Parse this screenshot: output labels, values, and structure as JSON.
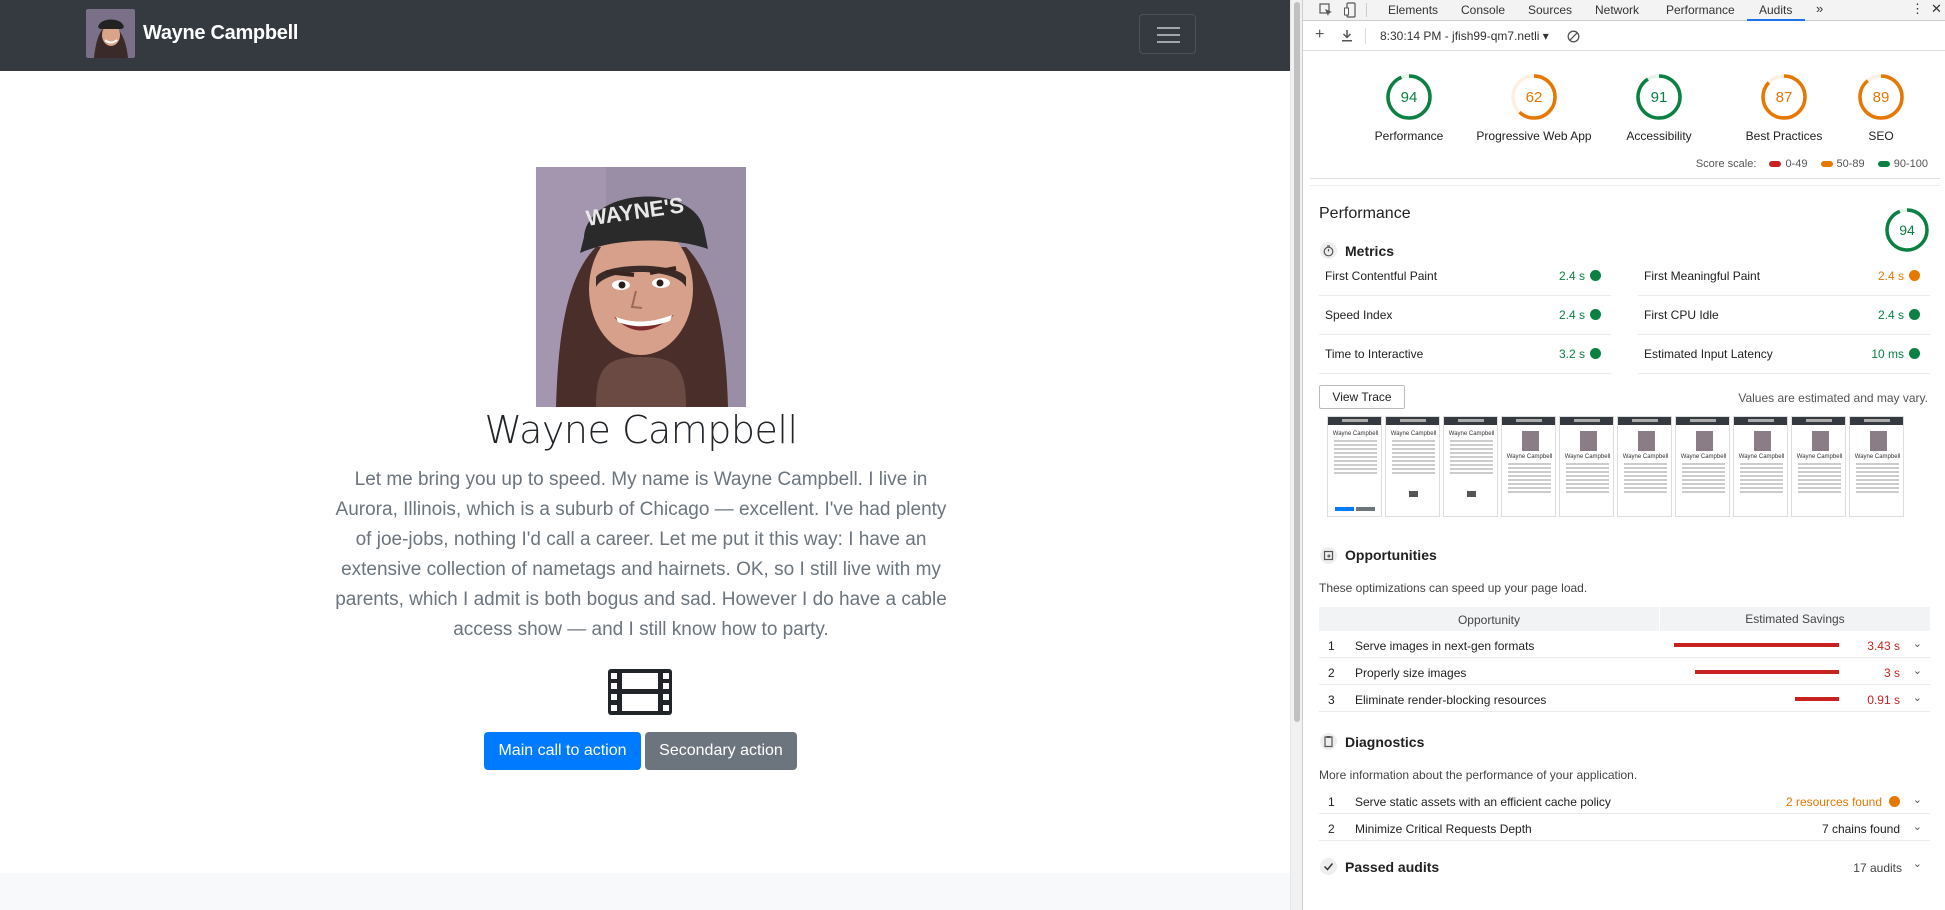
{
  "site": {
    "brand": "Wayne Campbell",
    "hero_title": "Wayne Campbell",
    "hero_text": "Let me bring you up to speed. My name is Wayne Campbell. I live in Aurora, Illinois, which is a suburb of Chicago — excellent. I've had plenty of joe-jobs, nothing I'd call a career. Let me put it this way: I have an extensive collection of nametags and hairnets. OK, so I still live with my parents, which I admit is both bogus and sad. However I do have a cable access show — and I still know how to party.",
    "hero_text_lines": [
      "Let me bring you up to speed. My name is Wayne Campbell. I live in",
      "Aurora, Illinois, which is a suburb of Chicago — excellent. I've had plenty",
      "of joe-jobs, nothing I'd call a career. Let me put it this way: I have an",
      "extensive collection of nametags and hairnets. OK, so I still live with my",
      "parents, which I admit is both bogus and sad. However I do have a cable",
      "access show — and I still know how to party."
    ],
    "hat_text": "WAYNE'S WORLD",
    "primary_button": "Main call to action",
    "secondary_button": "Secondary action",
    "icons": {
      "toggler": "hamburger-menu-icon",
      "feature": "film-icon"
    }
  },
  "devtools": {
    "tabs": [
      "Elements",
      "Console",
      "Sources",
      "Network",
      "Performance",
      "Audits"
    ],
    "active_tab": "Audits",
    "report_selector": "8:30:14 PM - jfish99-qm7.netli",
    "scores": [
      {
        "label": "Performance",
        "value": 94,
        "color": "#0b8043"
      },
      {
        "label": "Progressive Web App",
        "value": 62,
        "color": "#e67700"
      },
      {
        "label": "Accessibility",
        "value": 91,
        "color": "#0b8043"
      },
      {
        "label": "Best Practices",
        "value": 87,
        "color": "#e67700"
      },
      {
        "label": "SEO",
        "value": 89,
        "color": "#e67700"
      }
    ],
    "score_scale": {
      "label": "Score scale:",
      "ranges": [
        "0-49",
        "50-89",
        "90-100"
      ]
    },
    "performance": {
      "title": "Performance",
      "score": 94,
      "metrics_title": "Metrics",
      "metrics": [
        {
          "name": "First Contentful Paint",
          "value": "2.4 s",
          "status": "pass"
        },
        {
          "name": "First Meaningful Paint",
          "value": "2.4 s",
          "status": "average"
        },
        {
          "name": "Speed Index",
          "value": "2.4 s",
          "status": "pass"
        },
        {
          "name": "First CPU Idle",
          "value": "2.4 s",
          "status": "pass"
        },
        {
          "name": "Time to Interactive",
          "value": "3.2 s",
          "status": "pass"
        },
        {
          "name": "Estimated Input Latency",
          "value": "10 ms",
          "status": "pass"
        }
      ],
      "view_trace": "View Trace",
      "estimate_note": "Values are estimated and may vary.",
      "filmstrip_frame_title": "Wayne Campbell"
    },
    "opportunities": {
      "title": "Opportunities",
      "description": "These optimizations can speed up your page load.",
      "col_opportunity": "Opportunity",
      "col_savings": "Estimated Savings",
      "items": [
        {
          "n": "1",
          "name": "Serve images in next-gen formats",
          "value": "3.43 s",
          "seconds": 3.43
        },
        {
          "n": "2",
          "name": "Properly size images",
          "value": "3 s",
          "seconds": 3.0
        },
        {
          "n": "3",
          "name": "Eliminate render-blocking resources",
          "value": "0.91 s",
          "seconds": 0.91
        }
      ]
    },
    "diagnostics": {
      "title": "Diagnostics",
      "description": "More information about the performance of your application.",
      "items": [
        {
          "n": "1",
          "name": "Serve static assets with an efficient cache policy",
          "value": "2 resources found"
        },
        {
          "n": "2",
          "name": "Minimize Critical Requests Depth",
          "value": "7 chains found"
        }
      ]
    },
    "passed": {
      "title": "Passed audits",
      "count": "17 audits"
    },
    "colors": {
      "pass": "#0b8043",
      "average": "#e67700",
      "fail": "#c7221f",
      "accent": "#1a73e8"
    }
  }
}
